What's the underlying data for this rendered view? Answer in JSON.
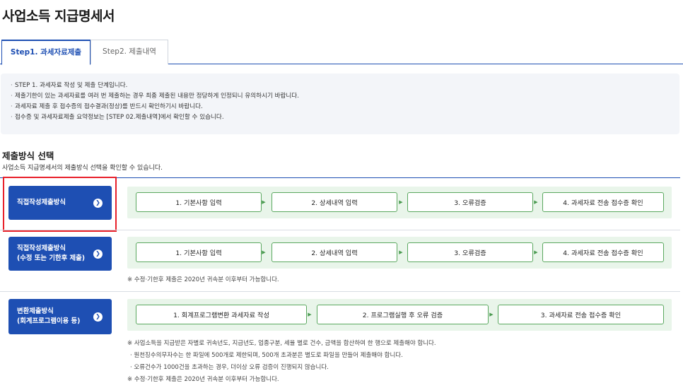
{
  "page": {
    "title": "사업소득 지급명세서"
  },
  "tabs": [
    {
      "label": "Step1. 과세자료제출",
      "active": true
    },
    {
      "label": "Step2. 제출내역",
      "active": false
    }
  ],
  "notice": {
    "lines": [
      "STEP 1. 과세자료 작성 및 제출 단계입니다.",
      "제출기한이 있는 과세자료를 여러 번 제출하는 경우 최종 제출된 내용만 정당하게 인정되니 유의하시기 바랍니다.",
      "과세자료 제출 후 접수증의 접수결과(정상)를 반드시 확인하기시 바랍니다.",
      "접수증 및 과세자료제출 요약정보는 [STEP 02.제출내역]에서 확인할 수 있습니다."
    ]
  },
  "section": {
    "title": "제출방식 선택",
    "description": "사업소득 지급명세서의 제출방식 선택을 확인할 수 있습니다."
  },
  "methods": [
    {
      "label_line1": "직접작성제출방식",
      "label_line2": "",
      "steps": [
        "1. 기본사항 입력",
        "2. 상세내역 입력",
        "3. 오류검증",
        "4. 과세자료 전송 접수증 확인"
      ],
      "notes": []
    },
    {
      "label_line1": "직접작성제출방식",
      "label_line2": "(수정 또는 기한후 제출)",
      "steps": [
        "1. 기본사항 입력",
        "2. 상세내역 입력",
        "3. 오류검증",
        "4. 과세자료 전송 접수증 확인"
      ],
      "notes": [
        "※ 수정·기한후 제출은 2020년 귀속분 이후부터 가능합니다."
      ]
    },
    {
      "label_line1": "변환제출방식",
      "label_line2": "(회계프로그램이용 등)",
      "steps": [
        "1. 회계프로그램변환 과세자료 작성",
        "2. 프로그램실행 후 오류 검증",
        "3. 과세자료 전송 접수증 확인"
      ],
      "notes": [
        "※ 사업소득을 지급받은 자별로 귀속년도, 지급년도, 업종구분, 세율 별로 건수, 금액을 합산하여 한 행으로 제출해야 합니다.",
        "· 원천징수의무자수는 한 파일에 500개로 제한되며, 500개 초과분은 별도로 파일을 만들어 제출해야 합니다.",
        "· 오류건수가 1000건을 초과하는 경우, 더이상 오류 검증이 진행되지 않습니다.",
        "※ 수정·기한후 제출은 2020년 귀속분 이후부터 가능합니다."
      ]
    }
  ],
  "icons": {
    "button_arrow": "chevron-right-icon",
    "step_separator": "triangle-right-icon"
  },
  "colors": {
    "primary": "#1e4fb3",
    "flow_bg": "#e9f5ea",
    "step_border": "#5aa85f",
    "highlight": "#e8202a"
  }
}
